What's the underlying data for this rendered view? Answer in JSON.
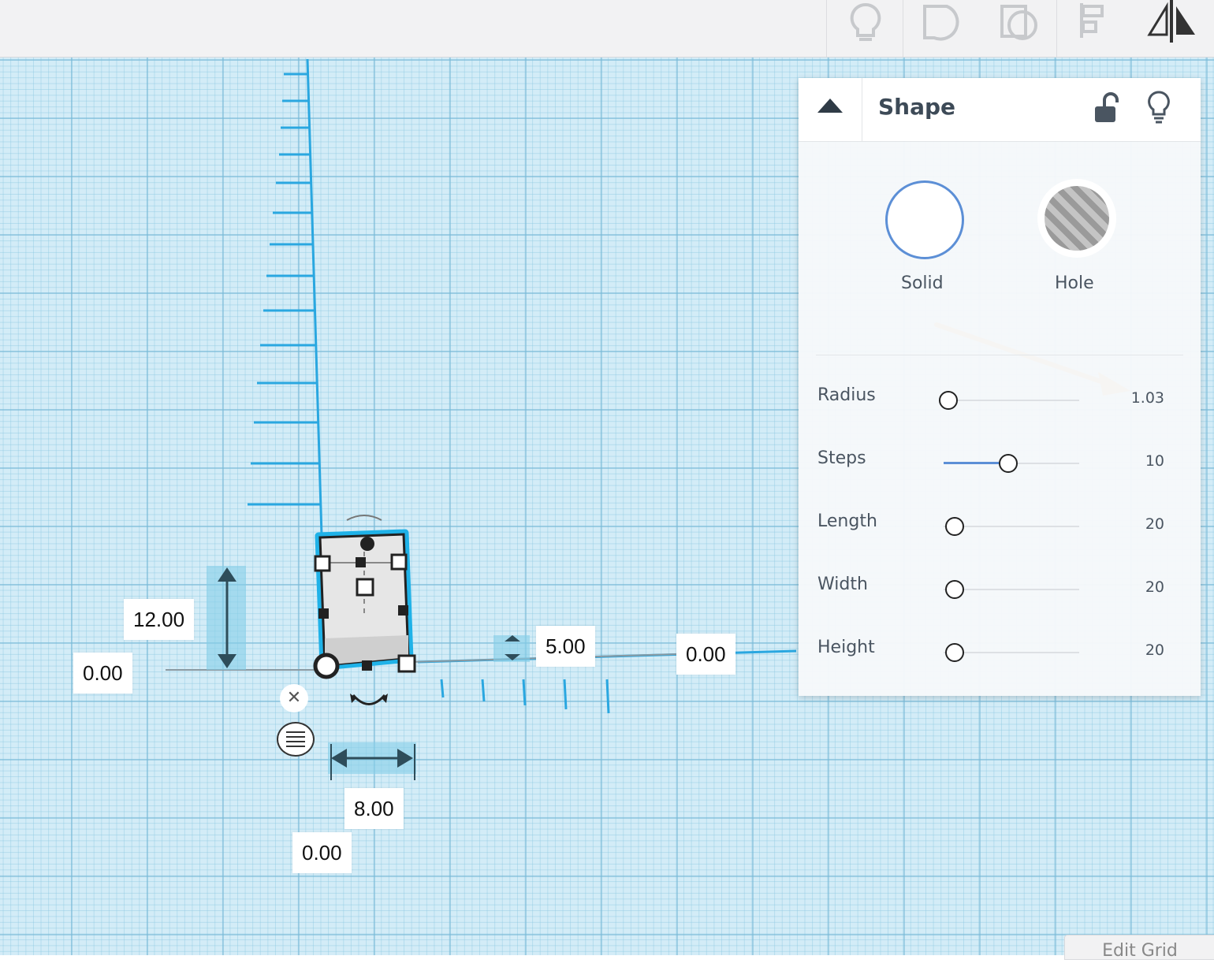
{
  "toolbar": {
    "icons": [
      "lightbulb-icon",
      "group-icon",
      "ungroup-icon",
      "align-icon",
      "mirror-icon"
    ]
  },
  "viewport": {
    "dimensions": {
      "height": "12.00",
      "z_offset": "0.00",
      "depth": "5.00",
      "x_offset": "0.00",
      "width": "8.00",
      "y_offset": "0.00"
    },
    "edit_grid_label": "Edit Grid",
    "accent_color": "#1fb2e8"
  },
  "inspector": {
    "title": "Shape",
    "modes": {
      "solid_label": "Solid",
      "hole_label": "Hole"
    },
    "properties": [
      {
        "label": "Radius",
        "value": "1.03",
        "level": 0.0
      },
      {
        "label": "Steps",
        "value": "10",
        "level": 0.5
      },
      {
        "label": "Length",
        "value": "20",
        "level": 0.05
      },
      {
        "label": "Width",
        "value": "20",
        "level": 0.05
      },
      {
        "label": "Height",
        "value": "20",
        "level": 0.05
      }
    ],
    "annotation_arrow_color": "#f39a2b"
  }
}
